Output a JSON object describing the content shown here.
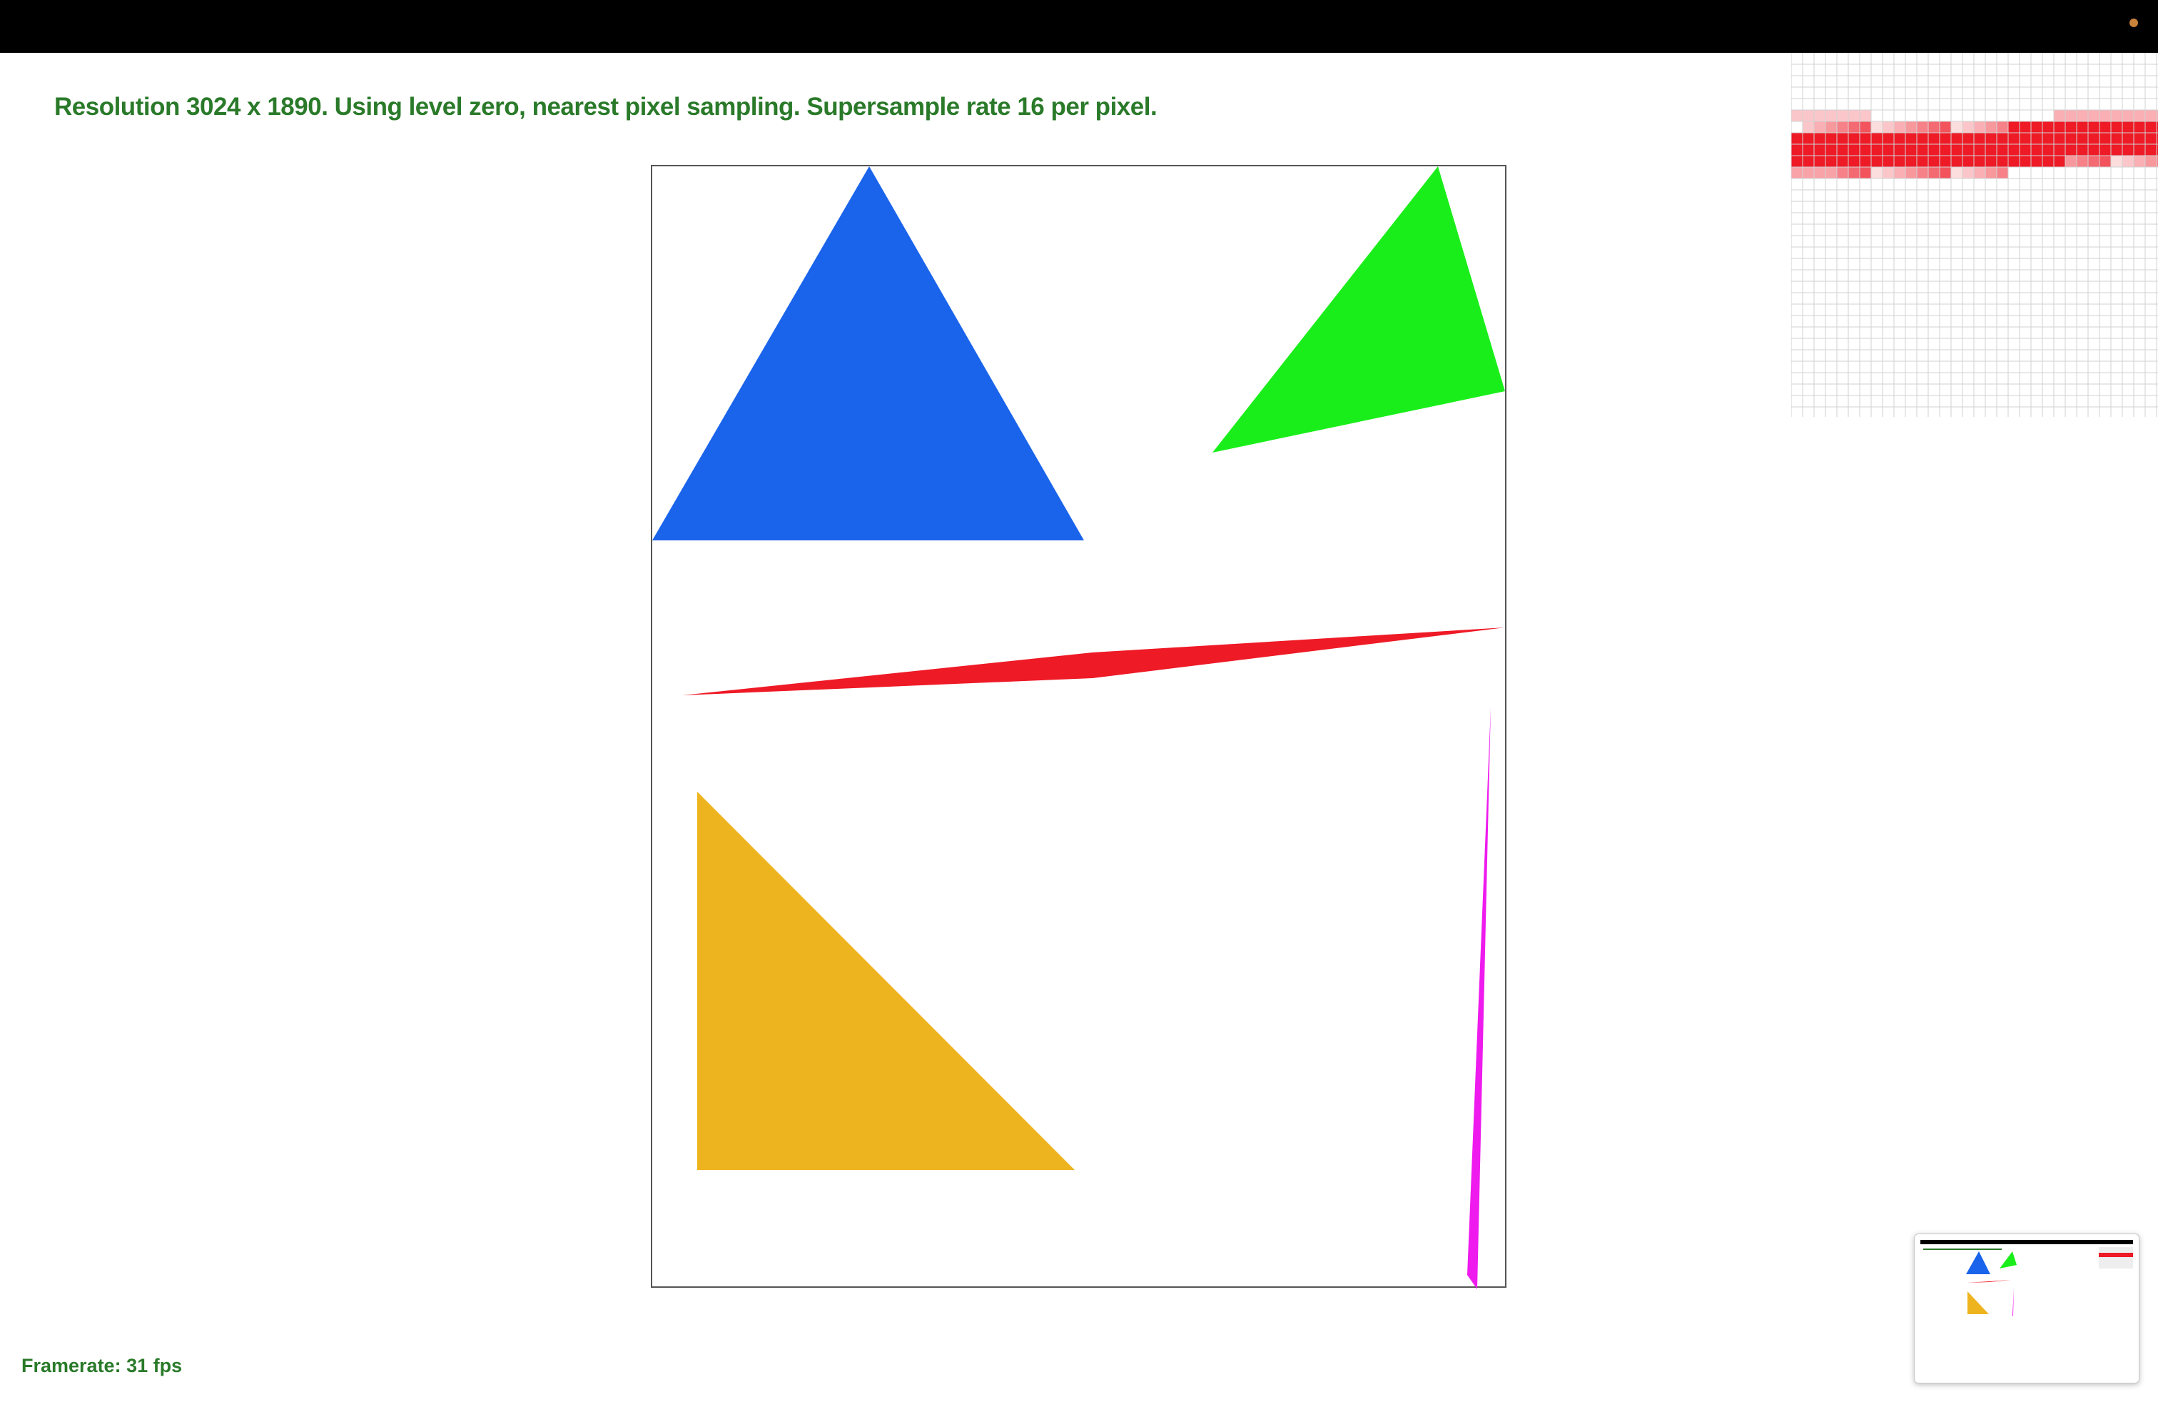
{
  "status_text": "Resolution 3024 x 1890. Using level zero, nearest pixel sampling. Supersample rate 16 per pixel.",
  "framerate_text": "Framerate: 31 fps",
  "colors": {
    "text": "#2a7a2a",
    "blue_triangle": "#1a64eb",
    "green_triangle": "#1aee1a",
    "red_triangle": "#ee1a26",
    "orange_triangle": "#eeb41f",
    "magenta_triangle": "#ee1aee",
    "topbar": "#000000"
  }
}
